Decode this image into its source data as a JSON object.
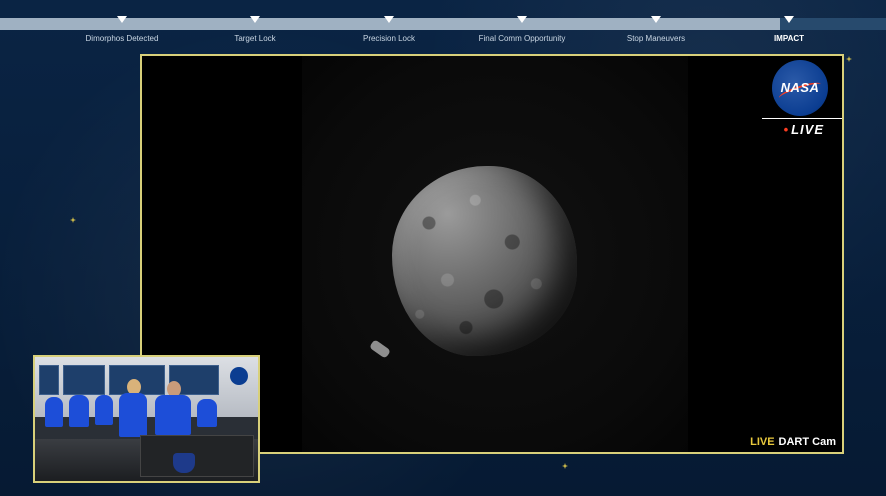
{
  "timeline": {
    "progress_percent": 88,
    "milestones": [
      {
        "label": "Dimorphos Detected",
        "active": false
      },
      {
        "label": "Target Lock",
        "active": false
      },
      {
        "label": "Precision Lock",
        "active": false
      },
      {
        "label": "Final Comm Opportunity",
        "active": false
      },
      {
        "label": "Stop Maneuvers",
        "active": false
      },
      {
        "label": "IMPACT",
        "active": true
      }
    ]
  },
  "video": {
    "logo_text": "NASA",
    "live_badge": "LIVE",
    "cam_live": "LIVE",
    "cam_name": "DART Cam"
  },
  "colors": {
    "background": "#061a33",
    "frame_border": "#d8d07a",
    "live_accent": "#e9c93d",
    "nasa_blue": "#0b3d91",
    "nasa_red": "#fc3d21"
  }
}
